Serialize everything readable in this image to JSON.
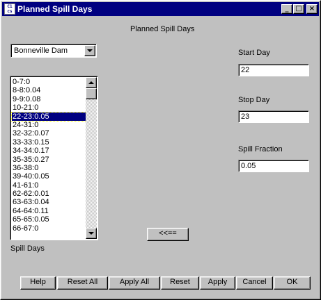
{
  "window": {
    "title": "Planned Spill Days",
    "icon_text": "C 1\n.cs",
    "minimize_glyph": "_",
    "maximize_glyph": "□",
    "close_glyph": "×"
  },
  "header": {
    "title": "Planned Spill Days"
  },
  "dam_select": {
    "value": "Bonneville Dam"
  },
  "spill_list": {
    "label": "Spill Days",
    "items": [
      "0-7:0",
      "8-8:0.04",
      "9-9:0.08",
      "10-21:0",
      "22-23:0.05",
      "24-31:0",
      "32-32:0.07",
      "33-33:0.15",
      "34-34:0.17",
      "35-35:0.27",
      "36-38:0",
      "39-40:0.05",
      "41-61:0",
      "62-62:0.01",
      "63-63:0.04",
      "64-64:0.11",
      "65-65:0.05",
      "66-67:0"
    ],
    "selected_index": 4
  },
  "start_day": {
    "label": "Start Day",
    "value": "22"
  },
  "stop_day": {
    "label": "Stop Day",
    "value": "23"
  },
  "spill_fraction": {
    "label": "Spill Fraction",
    "value": "0.05"
  },
  "transfer_button": {
    "label": "<<=="
  },
  "footer_buttons": {
    "help": "Help",
    "reset_all": "Reset All",
    "apply_all": "Apply All",
    "reset": "Reset",
    "apply": "Apply",
    "cancel": "Cancel",
    "ok": "OK"
  }
}
